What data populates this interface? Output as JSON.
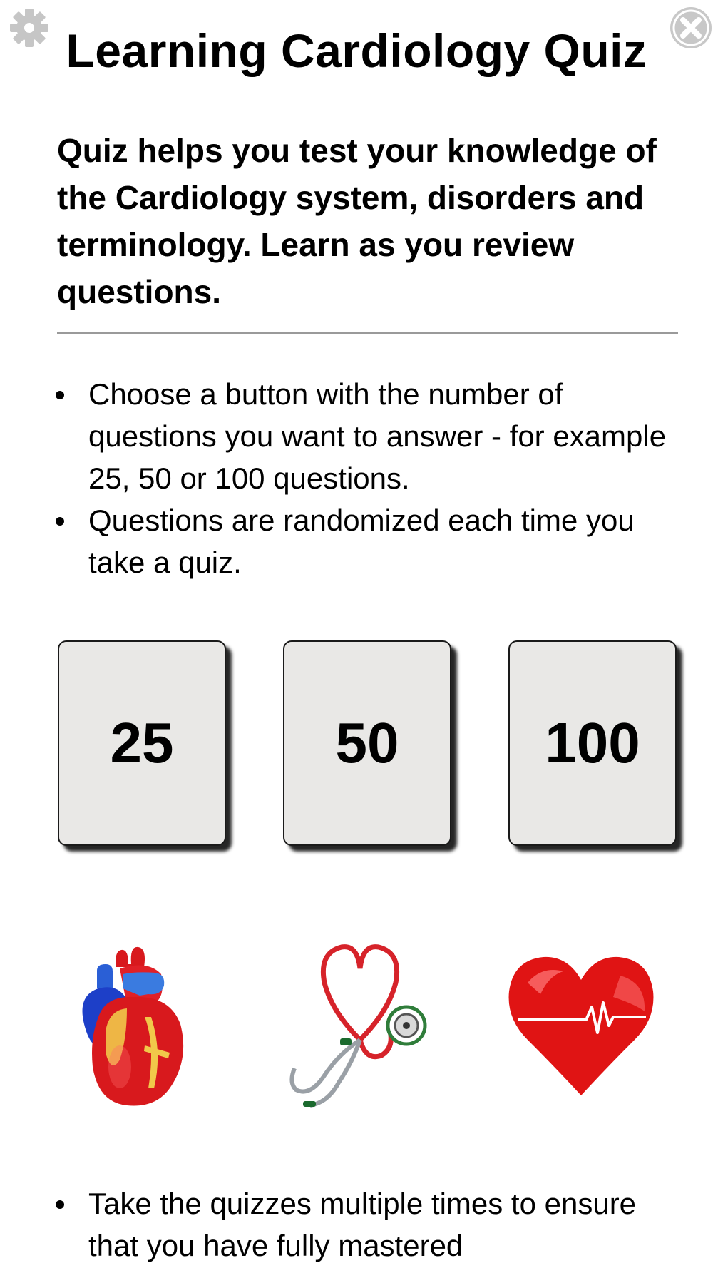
{
  "header": {
    "title": "Learning Cardiology Quiz",
    "settings_icon": "gear-icon",
    "close_icon": "close-circle-icon"
  },
  "intro": {
    "text": "Quiz helps you test your knowledge of the Cardiology system, disorders and terminology. Learn as you review questions."
  },
  "instructions": [
    "Choose a button with the number of questions you want to answer - for example 25, 50 or 100 questions.",
    "Questions are randomized each time you take a quiz."
  ],
  "quiz_buttons": [
    {
      "label": "25"
    },
    {
      "label": "50"
    },
    {
      "label": "100"
    }
  ],
  "illustrations": [
    "anatomical-heart-icon",
    "stethoscope-heart-icon",
    "heartbeat-heart-icon"
  ],
  "footer_tips": [
    "Take the quizzes multiple times to ensure that you have fully mastered"
  ],
  "colors": {
    "button_bg": "#e9e8e6",
    "divider": "#9a9a9a",
    "icon_gray": "#c8c8c8",
    "heart_red": "#e01414"
  }
}
